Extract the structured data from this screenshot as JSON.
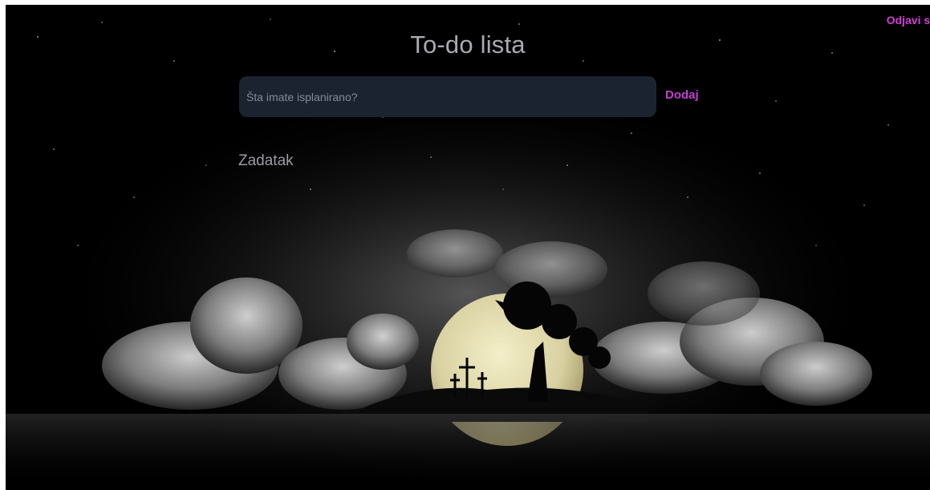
{
  "header": {
    "logout_label": "Odjavi se",
    "title": "To-do lista"
  },
  "todo_form": {
    "input_placeholder": "Šta imate isplanirano?",
    "input_value": "",
    "add_label": "Dodaj"
  },
  "task_list": {
    "column_header": "Zadatak",
    "items": []
  },
  "colors": {
    "accent": "#c23fd0",
    "background": "#000000",
    "input_background": "#1c2330",
    "title_text": "#a9aab0"
  }
}
